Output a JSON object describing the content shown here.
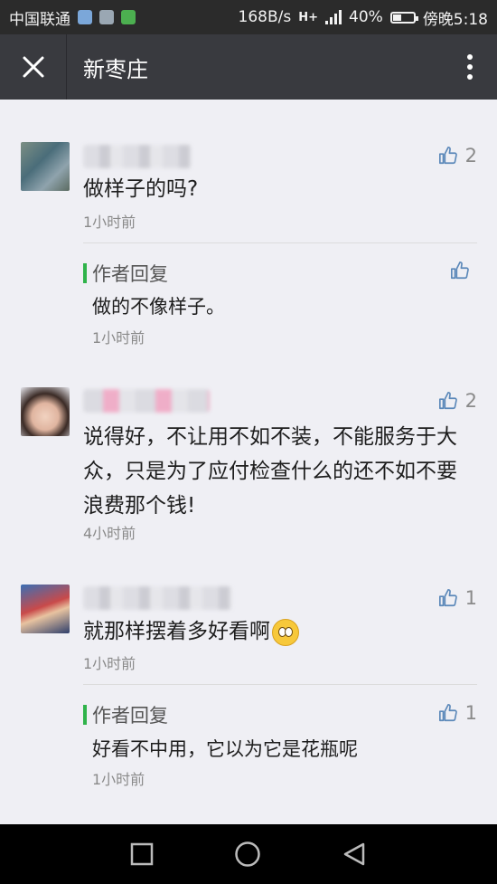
{
  "status_bar": {
    "carrier": "中国联通",
    "speed": "168B/s",
    "network": "H+",
    "battery_percent": "40%",
    "battery_level": 0.4,
    "time": "傍晚5:18"
  },
  "header": {
    "title": "新枣庄"
  },
  "comments": [
    {
      "text": "做样子的吗?",
      "time": "1小时前",
      "likes": "2",
      "reply": {
        "label": "作者回复",
        "text": "做的不像样子。",
        "time": "1小时前",
        "likes": ""
      }
    },
    {
      "text": "说得好，不让用不如不装，不能服务于大众，只是为了应付检查什么的还不如不要浪费那个钱!",
      "time": "4小时前",
      "likes": "2"
    },
    {
      "text": "就那样摆着多好看啊",
      "time": "1小时前",
      "likes": "1",
      "reply": {
        "label": "作者回复",
        "text": "好看不中用，它以为它是花瓶呢",
        "time": "1小时前",
        "likes": "1"
      }
    }
  ],
  "icons": {
    "close": "close-icon",
    "more": "more-vertical-icon",
    "like": "thumbs-up-icon",
    "emoji": "surprised-face-emoji"
  }
}
